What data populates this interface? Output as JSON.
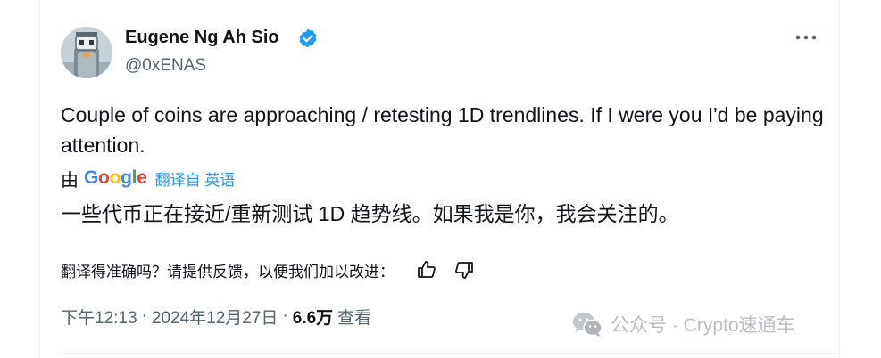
{
  "author": {
    "display_name": "Eugene Ng Ah Sio",
    "handle": "@0xENAS",
    "verified_icon": "verified-badge-icon",
    "avatar_icon": "pixel-avatar-icon"
  },
  "tweet": {
    "text": "Couple of coins are approaching / retesting 1D trendlines. If I were you I'd be paying attention."
  },
  "translation": {
    "by_label": "由",
    "google_letters": [
      "G",
      "o",
      "o",
      "g",
      "l",
      "e"
    ],
    "google_colors": [
      "#4285f4",
      "#ea4335",
      "#fbbc05",
      "#4285f4",
      "#34a853",
      "#ea4335"
    ],
    "translate_from_label": "翻译自 英语",
    "translated_text": "一些代币正在接近/重新测试 1D 趋势线。如果我是你，我会关注的。",
    "feedback_question": "翻译得准确吗？请提供反馈，以便我们加以改进：",
    "thumbs_up_icon": "thumbs-up-icon",
    "thumbs_down_icon": "thumbs-down-icon"
  },
  "meta": {
    "time": "下午12:13",
    "separator": "·",
    "date": "2024年12月27日",
    "views_count": "6.6万",
    "views_label": "查看"
  },
  "watermark": {
    "icon": "wechat-icon",
    "text": "公众号 · Crypto速通车"
  },
  "colors": {
    "text_primary": "#0f1419",
    "text_secondary": "#536471",
    "accent_blue": "#1d9bf0",
    "border": "#eff3f4"
  }
}
